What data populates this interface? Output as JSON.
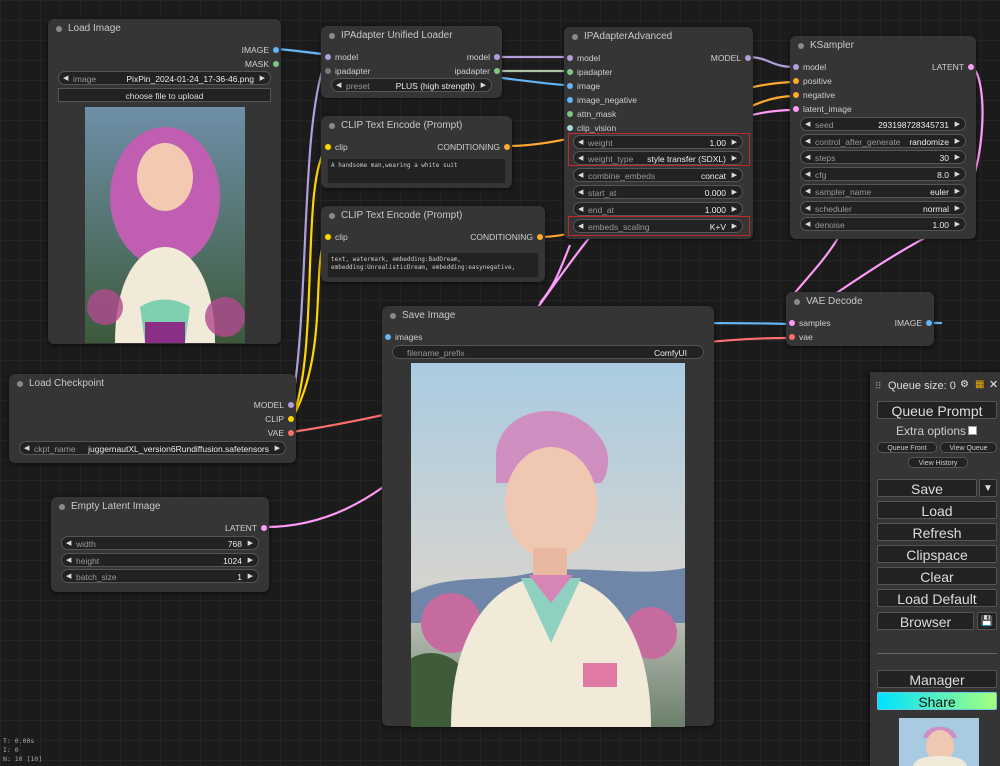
{
  "colors": {
    "image": "#64b5f6",
    "mask": "#81c784",
    "model": "#b39ddb",
    "ipadapter": "#b0c4a8",
    "conditioning": "#ffa931",
    "clip": "#ffd500",
    "vae": "#ff6e6e",
    "latent": "#ff9cf9",
    "clip_vision": "#a8dadc",
    "accent_red": "#c0282a"
  },
  "load_image": {
    "title": "Load Image",
    "out_image": "IMAGE",
    "out_mask": "MASK",
    "w_image_label": "image",
    "w_image_value": "PixPin_2024-01-24_17-36-46.png",
    "upload_label": "choose file to upload"
  },
  "ipa_loader": {
    "title": "IPAdapter Unified Loader",
    "in_model": "model",
    "in_ipadapter": "ipadapter",
    "out_model": "model",
    "out_ipadapter": "ipadapter",
    "w_preset_label": "preset",
    "w_preset_value": "PLUS (high strength)"
  },
  "clip1": {
    "title": "CLIP Text Encode (Prompt)",
    "in_clip": "clip",
    "out": "CONDITIONING",
    "text": "A handsome man,wearing a white suit"
  },
  "clip2": {
    "title": "CLIP Text Encode (Prompt)",
    "in_clip": "clip",
    "out": "CONDITIONING",
    "text": "text, watermark, embedding:BadDream, embedding:UnrealisticDream, embedding:easynegative,"
  },
  "ipa_adv": {
    "title": "IPAdapterAdvanced",
    "in_model": "model",
    "in_ipadapter": "ipadapter",
    "in_image": "image",
    "in_image_negative": "image_negative",
    "in_attn_mask": "attn_mask",
    "in_clip_vision": "clip_vision",
    "out_model": "MODEL",
    "w_weight_label": "weight",
    "w_weight_value": "1.00",
    "w_weight_type_label": "weight_type",
    "w_weight_type_value": "style transfer (SDXL)",
    "w_combine_label": "combine_embeds",
    "w_combine_value": "concat",
    "w_start_label": "start_at",
    "w_start_value": "0.000",
    "w_end_label": "end_at",
    "w_end_value": "1.000",
    "w_scaling_label": "embeds_scaling",
    "w_scaling_value": "K+V"
  },
  "ksampler": {
    "title": "KSampler",
    "in_model": "model",
    "in_positive": "positive",
    "in_negative": "negative",
    "in_latent": "latent_image",
    "out": "LATENT",
    "w_seed_label": "seed",
    "w_seed_value": "293198728345731",
    "w_cag_label": "control_after_generate",
    "w_cag_value": "randomize",
    "w_steps_label": "steps",
    "w_steps_value": "30",
    "w_cfg_label": "cfg",
    "w_cfg_value": "8.0",
    "w_sampler_label": "sampler_name",
    "w_sampler_value": "euler",
    "w_scheduler_label": "scheduler",
    "w_scheduler_value": "normal",
    "w_denoise_label": "denoise",
    "w_denoise_value": "1.00"
  },
  "vae_decode": {
    "title": "VAE Decode",
    "in_samples": "samples",
    "in_vae": "vae",
    "out": "IMAGE"
  },
  "save_image": {
    "title": "Save Image",
    "in_images": "images",
    "w_prefix_label": "filename_prefix",
    "w_prefix_value": "ComfyUI"
  },
  "checkpoint": {
    "title": "Load Checkpoint",
    "out_model": "MODEL",
    "out_clip": "CLIP",
    "out_vae": "VAE",
    "w_ckpt_label": "ckpt_name",
    "w_ckpt_value": "juggernautXL_version6Rundiffusion.safetensors"
  },
  "latent": {
    "title": "Empty Latent Image",
    "out": "LATENT",
    "w_width_label": "width",
    "w_width_value": "768",
    "w_height_label": "height",
    "w_height_value": "1024",
    "w_batch_label": "batch_size",
    "w_batch_value": "1"
  },
  "panel": {
    "queue_size": "Queue size: 0",
    "queue_prompt": "Queue Prompt",
    "extra_options": "Extra options",
    "queue_front": "Queue Front",
    "view_queue": "View Queue",
    "view_history": "View History",
    "save": "Save",
    "load": "Load",
    "refresh": "Refresh",
    "clipspace": "Clipspace",
    "clear": "Clear",
    "load_default": "Load Default",
    "browser": "Browser",
    "manager": "Manager",
    "share": "Share"
  },
  "stats": {
    "t": "T: 0.00s",
    "i": "I: 0",
    "n": "N: 10 [10]"
  }
}
